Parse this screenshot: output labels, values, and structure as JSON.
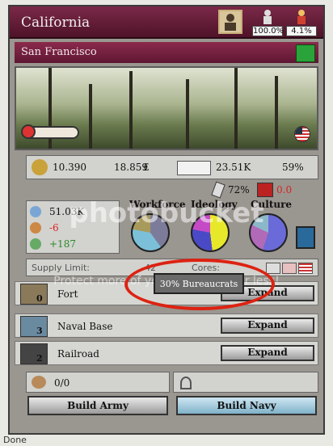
{
  "window": {
    "title": "California",
    "stat_left": "100.0%",
    "stat_right": "4.1%"
  },
  "province": {
    "name": "San Francisco"
  },
  "economy": {
    "money": "10.390",
    "income": "18.859",
    "income_unit": "£",
    "pops": "23.51K",
    "pop_pct": "59%",
    "literacy": "72%",
    "militancy": "0.0"
  },
  "population": {
    "total": "51.03K",
    "change": "-6",
    "growth": "+187"
  },
  "charts": {
    "workforce_label": "Workforce",
    "ideology_label": "Ideology",
    "culture_label": "Culture"
  },
  "supply": {
    "label": "Supply Limit:",
    "value": "42",
    "cores_label": "Cores:"
  },
  "tooltip": {
    "text": "30% Bureaucrats"
  },
  "buildings": [
    {
      "name": "Fort",
      "level": "0",
      "button": "Expand"
    },
    {
      "name": "Naval Base",
      "level": "3",
      "button": "Expand"
    },
    {
      "name": "Railroad",
      "level": "2",
      "button": "Expand"
    }
  ],
  "military": {
    "armies": "0/0",
    "build_army": "Build Army",
    "build_navy": "Build Navy"
  },
  "watermark": {
    "line1": "photobucket",
    "line2": "Protect more of your memories for less!"
  },
  "statusbar": {
    "text": "Done"
  }
}
